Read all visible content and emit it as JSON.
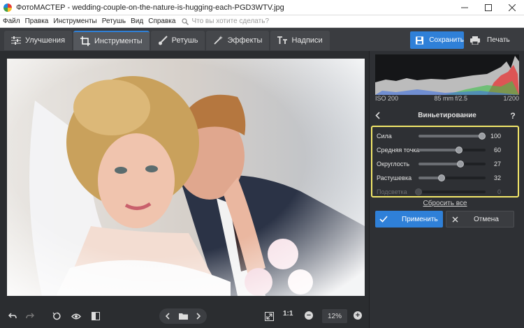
{
  "window": {
    "title": "ФотоМАСТЕР - wedding-couple-on-the-nature-is-hugging-each-PGD3WTV.jpg",
    "minimize_icon": "minimize-icon",
    "maximize_icon": "maximize-icon",
    "close_icon": "close-icon"
  },
  "menu": {
    "items": [
      "Файл",
      "Правка",
      "Инструменты",
      "Ретушь",
      "Вид",
      "Справка"
    ],
    "search_placeholder": "Что вы хотите сделать?"
  },
  "tabs": [
    {
      "label": "Улучшения",
      "icon": "sliders-icon"
    },
    {
      "label": "Инструменты",
      "icon": "crop-icon",
      "active": true
    },
    {
      "label": "Ретушь",
      "icon": "brush-icon"
    },
    {
      "label": "Эффекты",
      "icon": "magic-wand-icon"
    },
    {
      "label": "Надписи",
      "icon": "text-icon"
    }
  ],
  "actions": {
    "save_label": "Сохранить",
    "print_label": "Печать"
  },
  "exif": {
    "iso": "ISO 200",
    "lens": "85 mm f/2.5",
    "shutter": "1/200"
  },
  "panel": {
    "title": "Виньетирование",
    "help": "?",
    "sliders": [
      {
        "label": "Сила",
        "value": "100",
        "fraction": 0.95,
        "enabled": true
      },
      {
        "label": "Средняя точка",
        "value": "60",
        "fraction": 0.6,
        "enabled": true
      },
      {
        "label": "Округлость",
        "value": "27",
        "fraction": 0.63,
        "enabled": true
      },
      {
        "label": "Растушевка",
        "value": "32",
        "fraction": 0.34,
        "enabled": true
      },
      {
        "label": "Подсветка",
        "value": "0",
        "fraction": 0.0,
        "enabled": false
      }
    ],
    "reset_label": "Сбросить все",
    "apply_label": "Применить",
    "cancel_label": "Отмена"
  },
  "bottom": {
    "zoom_ratio": "1:1",
    "zoom_value": "12%",
    "zoom_out": "−",
    "zoom_in": "+"
  },
  "colors": {
    "accent": "#2f80d8",
    "highlight_frame": "#f3e86a"
  }
}
